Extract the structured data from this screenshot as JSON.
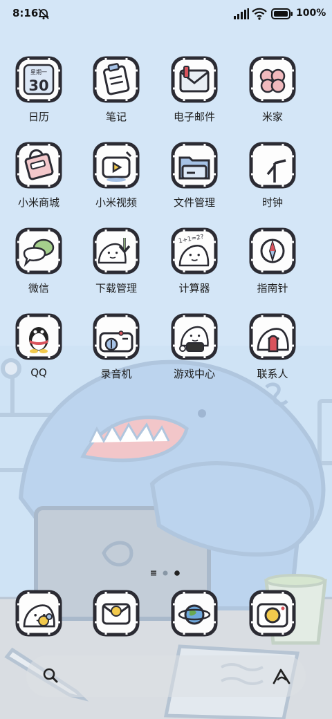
{
  "status": {
    "time": "8:16",
    "battery": "100%",
    "icons": [
      "muted-bell-icon",
      "signal-icon",
      "wifi-icon",
      "battery-icon"
    ]
  },
  "apps": [
    {
      "label": "日历",
      "icon": "calendar-icon",
      "weekday": "星期一",
      "day": "30"
    },
    {
      "label": "笔记",
      "icon": "notes-icon"
    },
    {
      "label": "电子邮件",
      "icon": "mail-icon"
    },
    {
      "label": "米家",
      "icon": "mijia-icon"
    },
    {
      "label": "小米商城",
      "icon": "shop-icon"
    },
    {
      "label": "小米视频",
      "icon": "video-icon"
    },
    {
      "label": "文件管理",
      "icon": "folder-icon"
    },
    {
      "label": "时钟",
      "icon": "clock-icon"
    },
    {
      "label": "微信",
      "icon": "wechat-icon"
    },
    {
      "label": "下载管理",
      "icon": "download-icon"
    },
    {
      "label": "计算器",
      "icon": "calculator-icon",
      "note": "1+1=2?"
    },
    {
      "label": "指南针",
      "icon": "compass-icon"
    },
    {
      "label": "QQ",
      "icon": "qq-penguin-icon"
    },
    {
      "label": "录音机",
      "icon": "recorder-icon"
    },
    {
      "label": "游戏中心",
      "icon": "game-center-icon"
    },
    {
      "label": "联系人",
      "icon": "contacts-icon"
    }
  ],
  "page_indicator": {
    "pages": 3,
    "current": 3
  },
  "dock": [
    {
      "icon": "phone-shark-icon"
    },
    {
      "icon": "messages-icon"
    },
    {
      "icon": "browser-planet-icon"
    },
    {
      "icon": "camera-icon"
    }
  ],
  "search_bar": {
    "left_icon": "search-icon",
    "right_icon": "assistant-icon"
  },
  "colors": {
    "sky": "#cfe3f5",
    "outline": "#2b2b33",
    "shark": "#a9c3e3",
    "ground": "#d9dde2"
  }
}
